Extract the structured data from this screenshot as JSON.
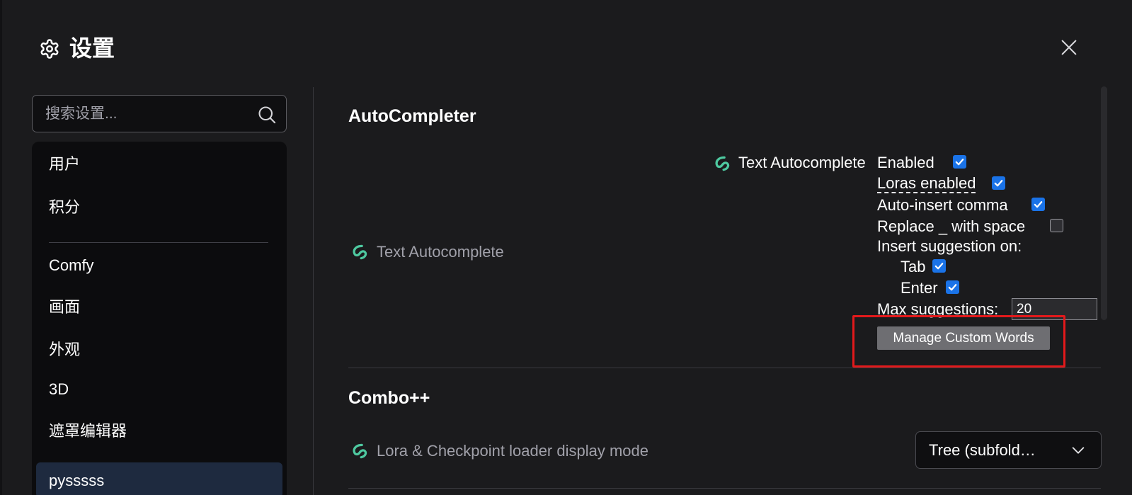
{
  "header": {
    "title": "设置",
    "gear_icon": "gear-icon",
    "close_icon": "close-icon"
  },
  "search": {
    "placeholder": "搜索设置..."
  },
  "sidebar": {
    "items": [
      {
        "label": "用户"
      },
      {
        "label": "积分"
      },
      {
        "label": "Comfy"
      },
      {
        "label": "画面"
      },
      {
        "label": "外观"
      },
      {
        "label": "3D"
      },
      {
        "label": "遮罩编辑器"
      },
      {
        "label": "pysssss"
      }
    ],
    "active_index": 7
  },
  "sections": {
    "autocompleter": {
      "title": "AutoCompleter",
      "setting_label": "Text Autocomplete",
      "panel": {
        "title": "Text Autocomplete",
        "enabled_label": "Enabled",
        "enabled": true,
        "loras_label": "Loras enabled",
        "loras": true,
        "comma_label": "Auto-insert comma",
        "comma": true,
        "replace_label": "Replace _ with space",
        "replace": false,
        "insert_on_label": "Insert suggestion on:",
        "tab_label": "Tab",
        "tab": true,
        "enter_label": "Enter",
        "enter": true,
        "max_label": "Max suggestions:",
        "max_value": "20",
        "manage_button": "Manage Custom Words"
      }
    },
    "combo": {
      "title": "Combo++",
      "setting_label": "Lora & Checkpoint loader display mode",
      "select_value": "Tree (subfold…"
    }
  },
  "colors": {
    "accent_checkbox": "#1a73e8",
    "highlight": "#e3191b",
    "brand_icon": "#4ec9a0",
    "background": "#1b1b1d",
    "sidebar": "#0c0c0e",
    "active_item": "#1e2a3f"
  }
}
